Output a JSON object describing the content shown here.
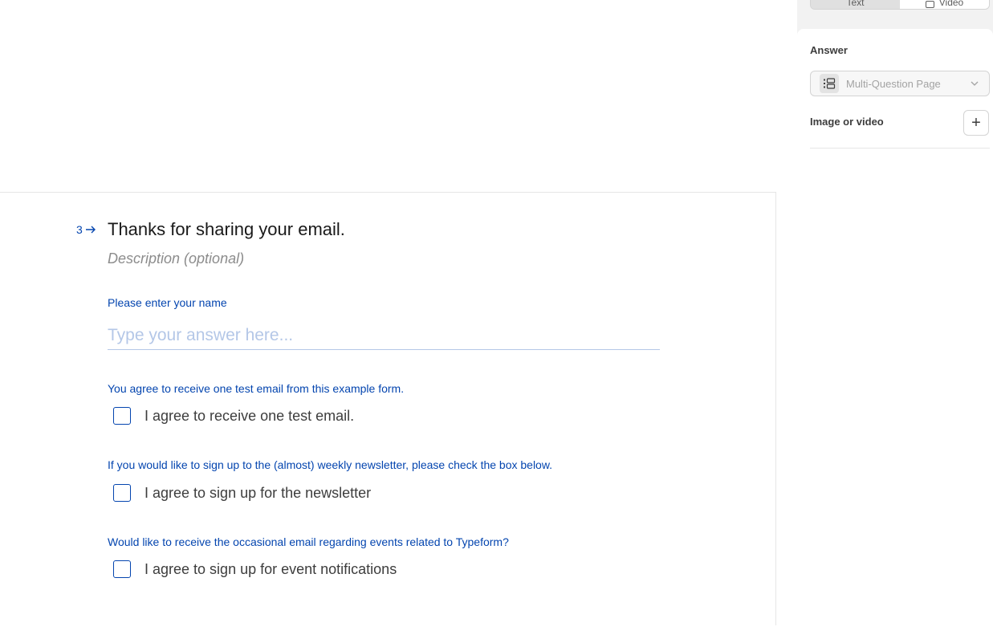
{
  "question": {
    "number": "3",
    "title": "Thanks for sharing your email.",
    "description_placeholder": "Description (optional)"
  },
  "fields": {
    "name": {
      "label": "Please enter your name",
      "placeholder": "Type your answer here..."
    },
    "agree_email": {
      "label": "You agree to receive one test email from this example form.",
      "option": "I agree to receive one test email."
    },
    "newsletter": {
      "label": "If you would like to sign up to the (almost) weekly newsletter, please check the box below.",
      "option": "I agree to sign up for the newsletter"
    },
    "events": {
      "label": "Would like to receive the occasional email regarding events related to Typeform?",
      "option": "I agree to sign up for event notifications"
    }
  },
  "sidebar": {
    "segment": {
      "options": [
        "Text",
        "Video"
      ],
      "selected": "Text"
    },
    "answer_label": "Answer",
    "answer_type": "Multi-Question Page",
    "media_label": "Image or video",
    "add_symbol": "+"
  },
  "colors": {
    "accent": "#0445af",
    "placeholder": "#b4c7e7",
    "sidebar_bg": "#f2f2f2"
  }
}
